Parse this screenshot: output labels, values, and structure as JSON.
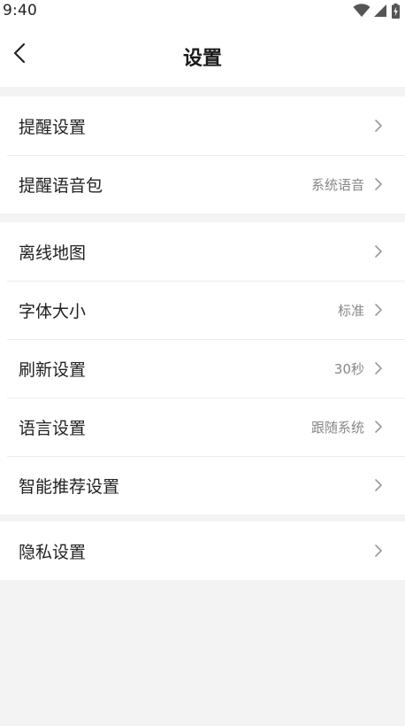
{
  "status_bar": {
    "time": "9:40",
    "icons": [
      "wifi-icon",
      "cellular-signal-icon",
      "battery-charging-icon"
    ]
  },
  "header": {
    "back_icon": "chevron-left-icon",
    "title": "设置"
  },
  "groups": [
    {
      "items": [
        {
          "label": "提醒设置",
          "value": ""
        },
        {
          "label": "提醒语音包",
          "value": "系统语音"
        }
      ]
    },
    {
      "items": [
        {
          "label": "离线地图",
          "value": ""
        },
        {
          "label": "字体大小",
          "value": "标准"
        },
        {
          "label": "刷新设置",
          "value": "30秒"
        },
        {
          "label": "语言设置",
          "value": "跟随系统"
        },
        {
          "label": "智能推荐设置",
          "value": ""
        }
      ]
    },
    {
      "items": [
        {
          "label": "隐私设置",
          "value": ""
        }
      ]
    }
  ],
  "colors": {
    "background": "#f3f3f3",
    "surface": "#ffffff",
    "text_primary": "#222222",
    "text_secondary": "#888888",
    "chevron": "#9a9a9a",
    "divider": "#ececec"
  }
}
